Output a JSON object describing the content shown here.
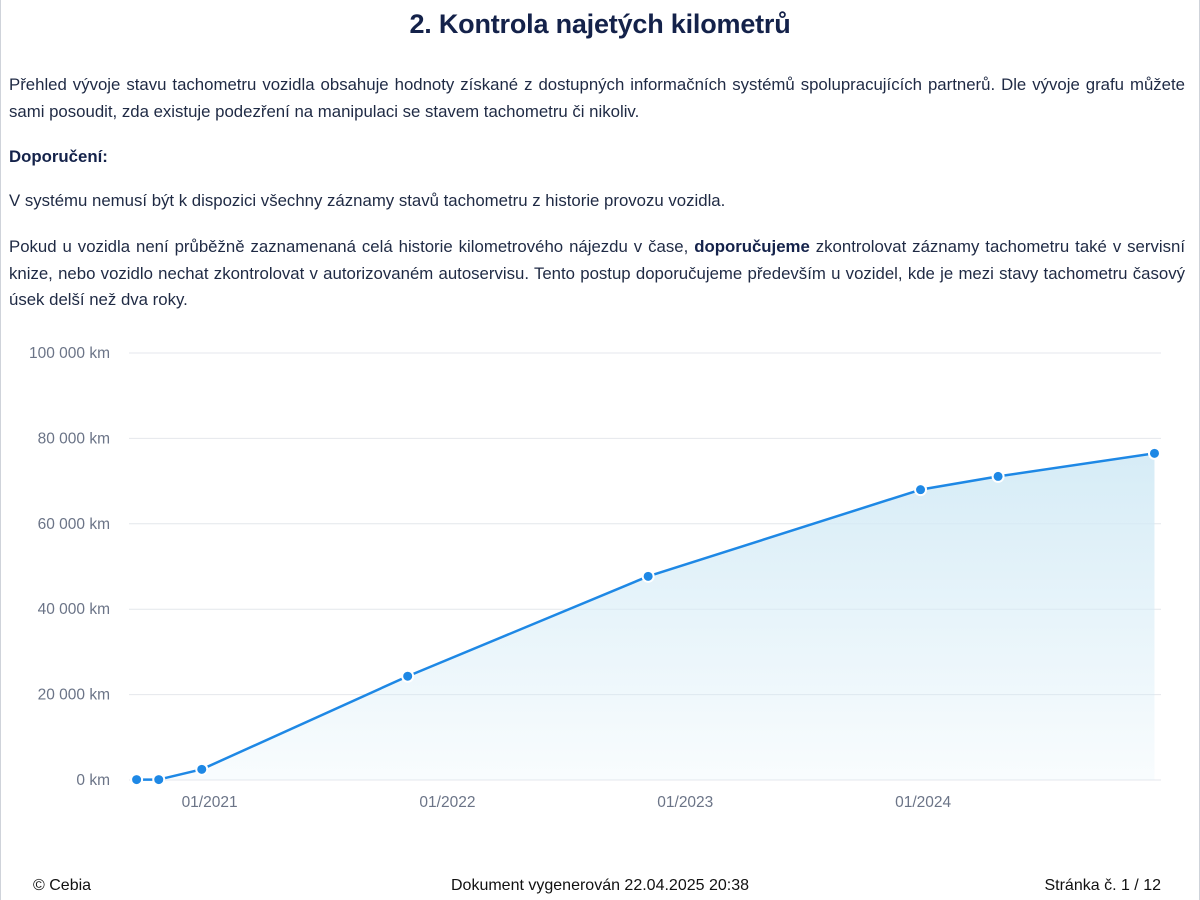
{
  "title": "2. Kontrola najetých kilometrů",
  "paragraph1": "Přehled vývoje stavu tachometru vozidla obsahuje hodnoty získané z dostupných informačních systémů spolupracujících partnerů. Dle vývoje grafu můžete sami posoudit, zda existuje podezření na manipulaci se stavem tachometru či nikoliv.",
  "recommendation_heading": "Doporučení:",
  "paragraph3": "V systému nemusí být k dispozici všechny záznamy stavů tachometru z historie provozu vozidla.",
  "paragraph4": {
    "before": "Pokud u vozidla není průběžně zaznamenaná celá historie kilometrového nájezdu v čase, ",
    "bold": "doporučujeme",
    "after": " zkontrolovat záznamy tachometru také v servisní knize, nebo vozidlo nechat zkontrolovat v autorizovaném autoservisu. Tento postup doporučujeme především u vozidel, kde je mezi stavy tachometru časový úsek delší než dva roky."
  },
  "footer": {
    "left": "© Cebia",
    "center": "Dokument vygenerován 22.04.2025 20:38",
    "right": "Stránka č. 1 / 12"
  },
  "chart_data": {
    "type": "area",
    "x_axis_type": "date",
    "xlim": [
      "2020-08-15",
      "2024-12-31"
    ],
    "ylim": [
      0,
      100000
    ],
    "yticks": [
      0,
      20000,
      40000,
      60000,
      80000,
      100000
    ],
    "ytick_labels": [
      "0 km",
      "20 000 km",
      "40 000 km",
      "60 000 km",
      "80 000 km",
      "100 000 km"
    ],
    "xticks": [
      "2021-01-01",
      "2022-01-01",
      "2023-01-01",
      "2024-01-01"
    ],
    "xtick_labels": [
      "01/2021",
      "01/2022",
      "01/2023",
      "01/2024"
    ],
    "grid": true,
    "series": [
      {
        "x": [
          "2020-09-11",
          "2020-10-15",
          "2020-12-20",
          "2021-11-01",
          "2022-11-05",
          "2023-12-28",
          "2024-04-25",
          "2024-12-21"
        ],
        "y": [
          100,
          100,
          2500,
          24300,
          47700,
          68000,
          71100,
          76500
        ]
      }
    ],
    "colors": {
      "line": "#1e88e5",
      "fill": "#d4ebf6",
      "grid": "#e4e7ec",
      "tick_text": "#6b7487"
    }
  }
}
